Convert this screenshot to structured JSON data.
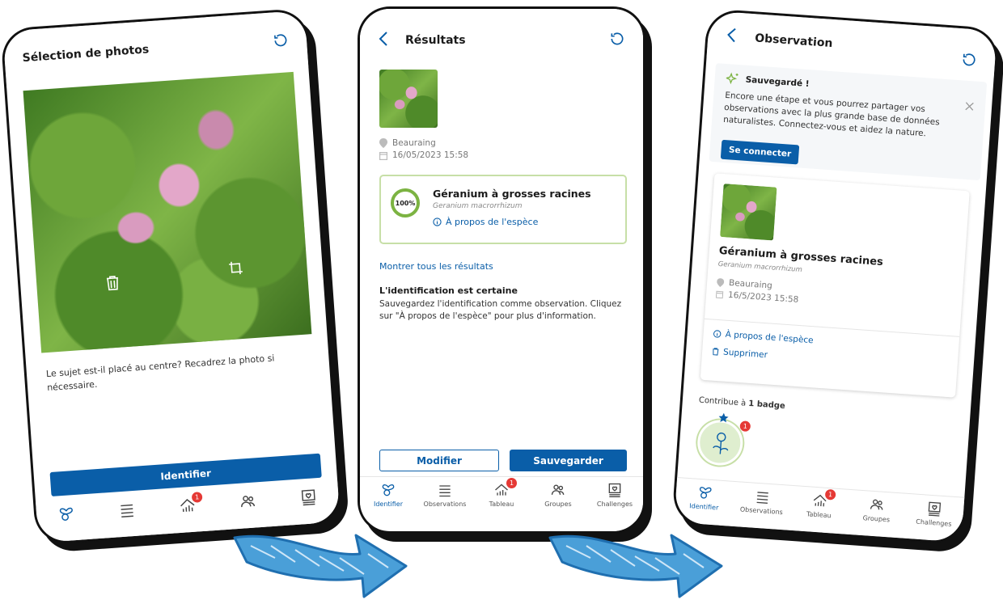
{
  "screen1": {
    "title": "Sélection de photos",
    "instruction": "Le sujet est-il placé au centre? Recadrez la photo si nécessaire.",
    "identify_button": "Identifier"
  },
  "screen2": {
    "title": "Résultats",
    "location": "Beauraing",
    "datetime": "16/05/2023 15:58",
    "result": {
      "confidence": "100%",
      "common_name": "Géranium à grosses racines",
      "latin_name": "Geranium macrorrhizum",
      "about_link": "À propos de l'espèce"
    },
    "show_all_link": "Montrer tous les résultats",
    "certainty_title": "L'identification est certaine",
    "certainty_text": "Sauvegardez l'identification comme observation. Cliquez sur \"À propos de l'espèce\" pour plus d'information.",
    "modify_button": "Modifier",
    "save_button": "Sauvegarder"
  },
  "screen3": {
    "title": "Observation",
    "banner": {
      "title": "Sauvegardé !",
      "text": "Encore une étape et vous pourrez partager vos observations avec la plus grande base de données naturalistes. Connectez-vous et aidez la nature.",
      "connect_button": "Se connecter"
    },
    "card": {
      "common_name": "Géranium à grosses racines",
      "latin_name": "Geranium macrorrhizum",
      "location": "Beauraing",
      "datetime": "16/5/2023 15:58",
      "about_link": "À propos de l'espèce",
      "delete_link": "Supprimer"
    },
    "contributes_prefix": "Contribue à",
    "contributes_value": "1 badge",
    "badge_count": "1"
  },
  "nav": {
    "identify": "Identifier",
    "observations": "Observations",
    "dashboard": "Tableau",
    "groups": "Groupes",
    "challenges": "Challenges",
    "dashboard_badge": "1"
  },
  "colors": {
    "primary": "#0a5ea8",
    "success": "#7cb342",
    "alert": "#e53935"
  }
}
